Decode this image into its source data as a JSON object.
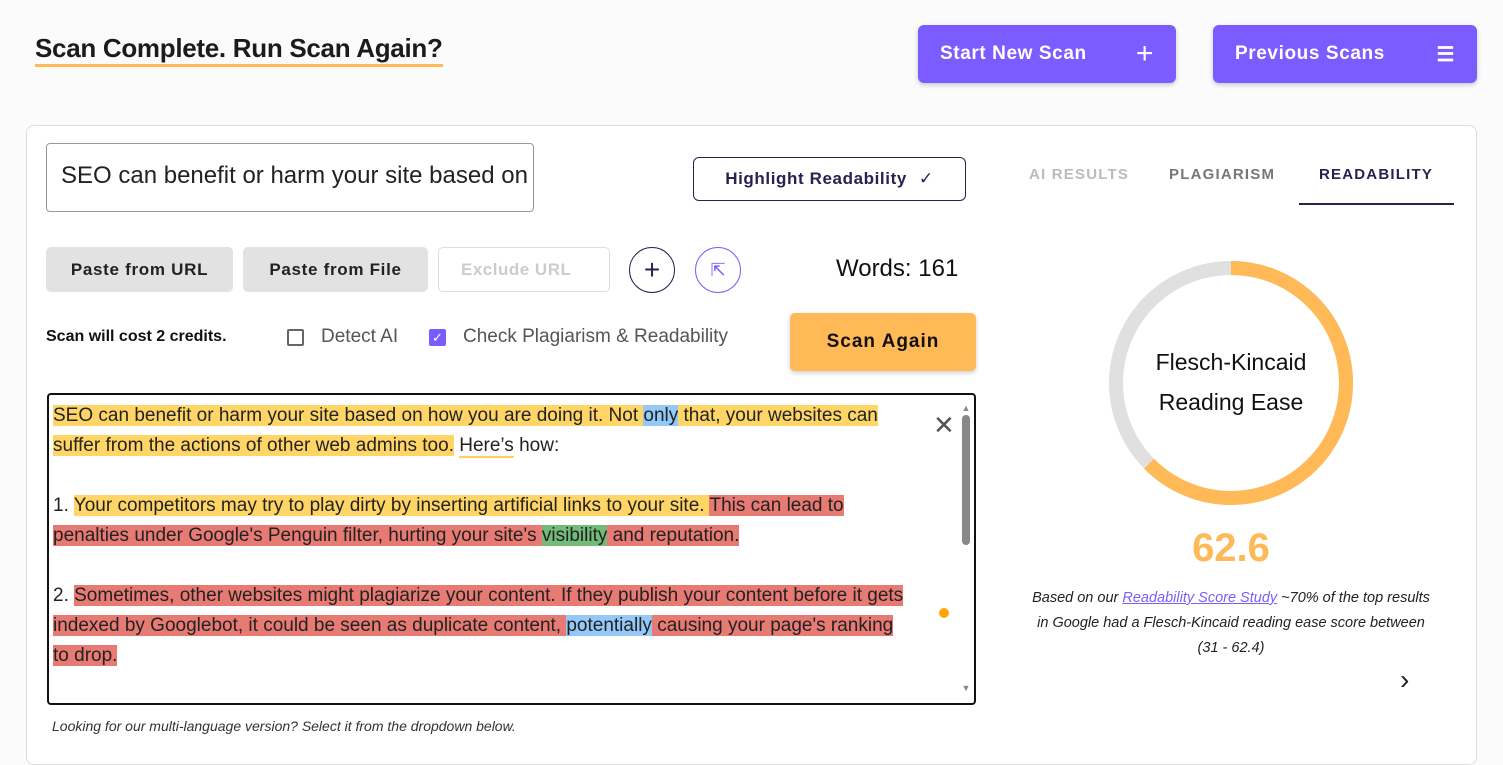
{
  "header": {
    "title_parts": [
      "Scan",
      " Complete. ",
      "Run Scan Again?"
    ],
    "title": "Scan Complete. Run Scan Again?",
    "start_new_scan": "Start New Scan",
    "previous_scans": "Previous Scans"
  },
  "colors": {
    "primary": "#7b5cff",
    "accent": "#ffb957",
    "dark": "#262350"
  },
  "input": {
    "value": "SEO can benefit or harm your site based on how you are doing it."
  },
  "highlight_button": "Highlight Readability",
  "tabs": [
    {
      "label": "AI RESULTS",
      "state": "disabled"
    },
    {
      "label": "PLAGIARISM",
      "state": "inactive"
    },
    {
      "label": "READABILITY",
      "state": "active"
    }
  ],
  "toolbar": {
    "paste_url": "Paste from URL",
    "paste_file": "Paste from File",
    "exclude_placeholder": "Exclude URL",
    "words": "Words: 161"
  },
  "options": {
    "cost": "Scan will cost 2 credits.",
    "detect_ai": {
      "label": "Detect AI",
      "checked": false
    },
    "check_plag": {
      "label": "Check Plagiarism & Readability",
      "checked": true
    }
  },
  "scan_again": "Scan Again",
  "editor": {
    "lines": [
      [
        {
          "t": "SEO can benefit or harm your site based on how you are doing it. Not ",
          "c": "y"
        },
        {
          "t": "only",
          "c": "b"
        },
        {
          "t": " that, your websites can",
          "c": "y"
        }
      ],
      [
        {
          "t": "suffer from the actions of other web admins too.",
          "c": "y"
        },
        {
          "t": " ",
          "c": ""
        },
        {
          "t": "Here’s",
          "c": "ul"
        },
        {
          "t": " how:",
          "c": ""
        }
      ],
      [],
      [
        {
          "t": "1. ",
          "c": ""
        },
        {
          "t": "Your competitors may try to play dirty by inserting artificial links to your site. ",
          "c": "y"
        },
        {
          "t": "This can lead to",
          "c": "r"
        }
      ],
      [
        {
          "t": "penalties under Google's Penguin filter, hurting your site's ",
          "c": "r"
        },
        {
          "t": "visibility",
          "c": "g"
        },
        {
          "t": " and reputation.",
          "c": "r"
        }
      ],
      [],
      [
        {
          "t": "2. ",
          "c": ""
        },
        {
          "t": "Sometimes, other websites might plagiarize your content. If they publish your content before it gets",
          "c": "r"
        }
      ],
      [
        {
          "t": "indexed by Googlebot, it could be seen as duplicate content, ",
          "c": "r"
        },
        {
          "t": "potentially",
          "c": "b"
        },
        {
          "t": " causing your page's ranking",
          "c": "r"
        }
      ],
      [
        {
          "t": "to drop.",
          "c": "r"
        }
      ]
    ]
  },
  "readability": {
    "metric_line1": "Flesch-Kincaid",
    "metric_line2": "Reading Ease",
    "score": "62.6",
    "score_value": 62.6,
    "desc_before": "Based on our ",
    "desc_link": "Readability Score Study",
    "desc_after": " ~70% of the top results in Google had a Flesch-Kincaid reading ease score between (31 - 62.4)"
  },
  "footer": "Looking for our multi-language version? Select it from the dropdown below."
}
